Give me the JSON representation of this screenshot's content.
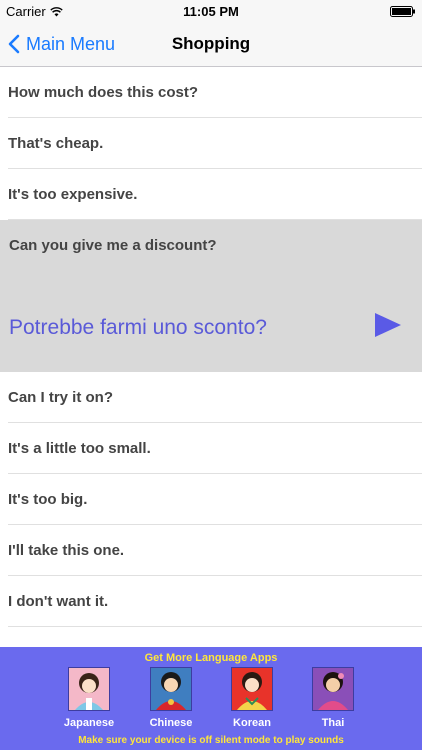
{
  "status_bar": {
    "carrier": "Carrier",
    "time": "11:05 PM"
  },
  "nav": {
    "back_label": "Main Menu",
    "title": "Shopping"
  },
  "phrases": [
    {
      "text": "How much does this cost?"
    },
    {
      "text": "That's cheap."
    },
    {
      "text": "It's too expensive."
    },
    {
      "text": "Can you give me a discount?",
      "translation": "Potrebbe farmi uno sconto?",
      "expanded": true
    },
    {
      "text": "Can I try it on?"
    },
    {
      "text": "It's a little too small."
    },
    {
      "text": "It's too big."
    },
    {
      "text": "I'll take this one."
    },
    {
      "text": "I don't want it."
    }
  ],
  "promo": {
    "title": "Get More Language Apps",
    "apps": [
      {
        "label": "Japanese"
      },
      {
        "label": "Chinese"
      },
      {
        "label": "Korean"
      },
      {
        "label": "Thai"
      }
    ],
    "footer": "Make sure your device is off silent mode to play sounds"
  },
  "colors": {
    "accent": "#1a7bff",
    "translation": "#5a5ad8",
    "promo_bg": "#6a6aee",
    "promo_text": "#ffe63a"
  }
}
